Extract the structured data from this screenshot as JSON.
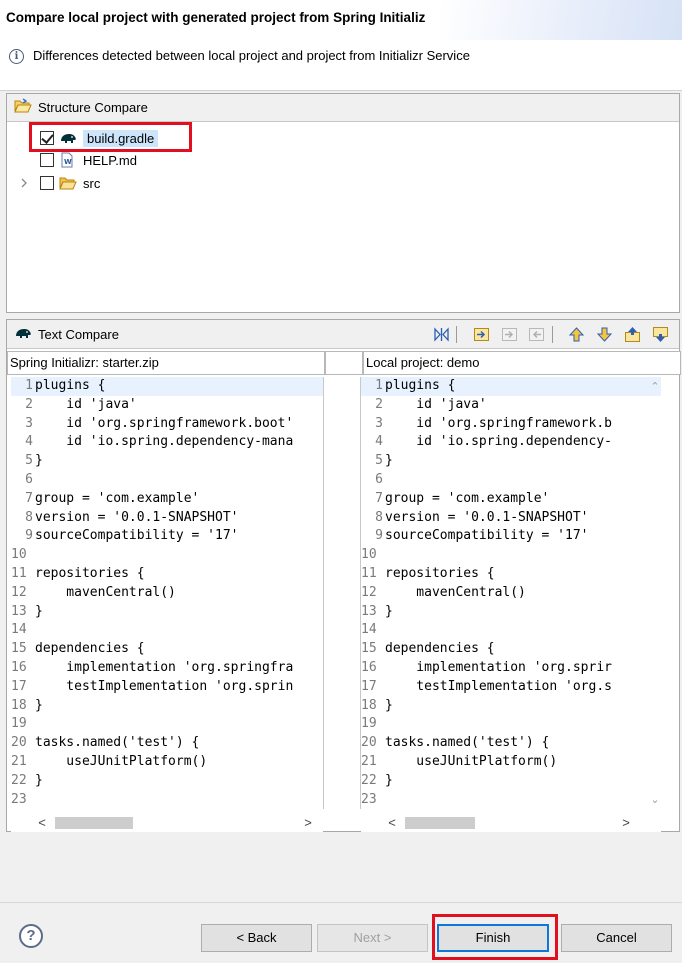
{
  "header": {
    "title": "Compare local project with generated project from Spring Initializ",
    "message": "Differences detected between local project and project from Initializr Service"
  },
  "structure": {
    "title": "Structure Compare",
    "items": [
      {
        "label": "build.gradle",
        "checked": true,
        "selected": true,
        "icon": "gradle-elephant-icon"
      },
      {
        "label": "HELP.md",
        "checked": false,
        "selected": false,
        "icon": "markdown-file-icon"
      },
      {
        "label": "src",
        "checked": false,
        "selected": false,
        "icon": "folder-icon",
        "expandable": true
      }
    ]
  },
  "text_compare": {
    "title": "Text Compare",
    "left_title": "Spring Initializr: starter.zip",
    "right_title": "Local project: demo",
    "left_lines": [
      "plugins {",
      "    id 'java'",
      "    id 'org.springframework.boot'",
      "    id 'io.spring.dependency-mana",
      "}",
      "",
      "group = 'com.example'",
      "version = '0.0.1-SNAPSHOT'",
      "sourceCompatibility = '17'",
      "",
      "repositories {",
      "    mavenCentral()",
      "}",
      "",
      "dependencies {",
      "    implementation 'org.springfra",
      "    testImplementation 'org.sprin",
      "}",
      "",
      "tasks.named('test') {",
      "    useJUnitPlatform()",
      "}",
      ""
    ],
    "right_lines": [
      "plugins {",
      "    id 'java'",
      "    id 'org.springframework.b",
      "    id 'io.spring.dependency-",
      "}",
      "",
      "group = 'com.example'",
      "version = '0.0.1-SNAPSHOT'",
      "sourceCompatibility = '17'",
      "",
      "repositories {",
      "    mavenCentral()",
      "}",
      "",
      "dependencies {",
      "    implementation 'org.sprir",
      "    testImplementation 'org.s",
      "}",
      "",
      "tasks.named('test') {",
      "    useJUnitPlatform()",
      "}",
      ""
    ]
  },
  "buttons": {
    "help": "?",
    "back": "< Back",
    "next": "Next >",
    "finish": "Finish",
    "cancel": "Cancel"
  },
  "colors": {
    "highlight_box": "#e01020",
    "selection": "#cce5fb",
    "default_button_border": "#0f78d7"
  }
}
